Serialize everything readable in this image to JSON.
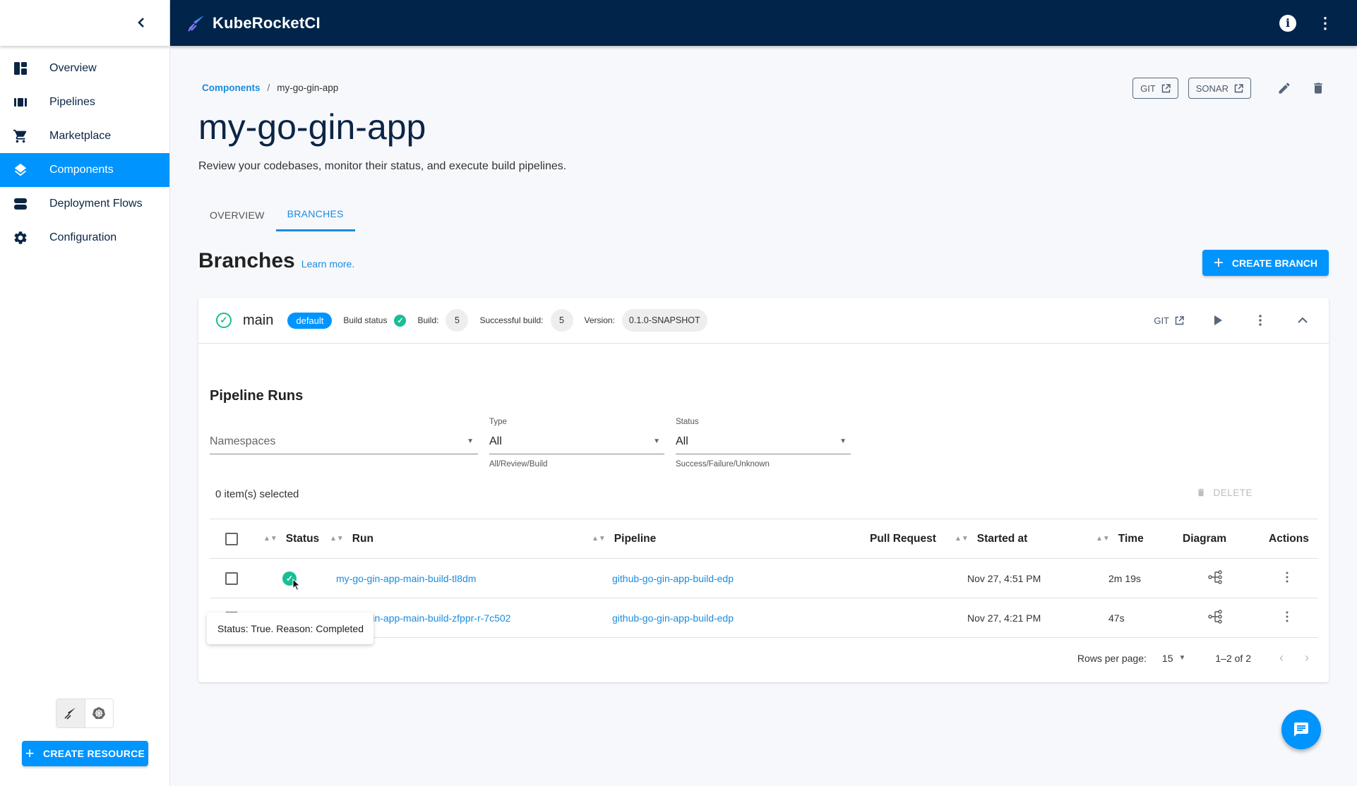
{
  "app": {
    "name": "KubeRocketCI"
  },
  "sidebar": {
    "items": [
      {
        "label": "Overview",
        "icon": "dashboard-icon"
      },
      {
        "label": "Pipelines",
        "icon": "pipelines-icon"
      },
      {
        "label": "Marketplace",
        "icon": "cart-icon"
      },
      {
        "label": "Components",
        "icon": "layers-icon",
        "active": true
      },
      {
        "label": "Deployment Flows",
        "icon": "deployment-flows-icon"
      },
      {
        "label": "Configuration",
        "icon": "gear-icon"
      }
    ],
    "create_resource_label": "CREATE RESOURCE"
  },
  "breadcrumb": {
    "parent": "Components",
    "separator": "/",
    "current": "my-go-gin-app"
  },
  "page": {
    "title": "my-go-gin-app",
    "description": "Review your codebases, monitor their status, and execute build pipelines.",
    "git_label": "GIT",
    "sonar_label": "SONAR"
  },
  "tabs": [
    {
      "label": "OVERVIEW"
    },
    {
      "label": "BRANCHES",
      "active": true
    }
  ],
  "branches": {
    "heading": "Branches",
    "learn_more": "Learn more.",
    "create_label": "CREATE BRANCH"
  },
  "branch": {
    "name": "main",
    "badge": "default",
    "build_status_label": "Build status",
    "build_label": "Build:",
    "build_value": "5",
    "successful_label": "Successful build:",
    "successful_value": "5",
    "version_label": "Version:",
    "version_value": "0.1.0-SNAPSHOT",
    "git_label": "GIT"
  },
  "pipeline_runs": {
    "title": "Pipeline Runs",
    "filters": {
      "namespaces_placeholder": "Namespaces",
      "type_label": "Type",
      "type_value": "All",
      "type_help": "All/Review/Build",
      "status_label": "Status",
      "status_value": "All",
      "status_help": "Success/Failure/Unknown"
    },
    "selected_text": "0 item(s) selected",
    "delete_label": "DELETE",
    "columns": [
      "Status",
      "Run",
      "Pipeline",
      "Pull Request",
      "Started at",
      "Time",
      "Diagram",
      "Actions"
    ],
    "rows": [
      {
        "run": "my-go-gin-app-main-build-tl8dm",
        "pipeline": "github-go-gin-app-build-edp",
        "pull_request": "",
        "started": "Nov 27, 4:51 PM",
        "time": "2m 19s"
      },
      {
        "run": "my-go-gin-app-main-build-zfppr-r-7c502",
        "run_visible": "-gin-app-main-build-zfppr-r-7c502",
        "pipeline": "github-go-gin-app-build-edp",
        "pull_request": "",
        "started": "Nov 27, 4:21 PM",
        "time": "47s"
      }
    ],
    "tooltip": "Status: True. Reason: Completed",
    "pagination": {
      "rows_per_page_label": "Rows per page:",
      "rows_per_page": "15",
      "range": "1–2 of 2"
    }
  },
  "colors": {
    "primary": "#0094ff",
    "header": "#00244a",
    "success": "#18be94",
    "link": "#1a8cdf"
  }
}
